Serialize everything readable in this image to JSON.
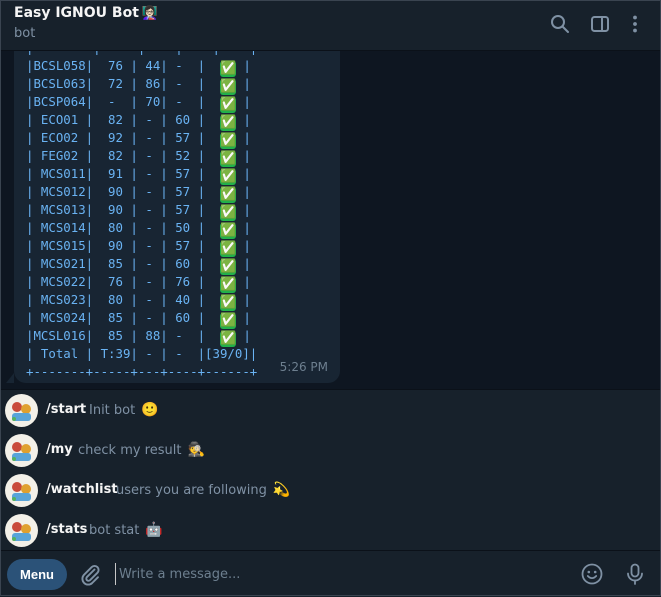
{
  "header": {
    "title": "Easy IGNOU Bot",
    "title_emoji": "👩🏻‍🏫",
    "subtitle": "bot",
    "icons": [
      "search-icon",
      "sidebar-icon",
      "more-vertical-icon"
    ]
  },
  "message": {
    "rows": [
      {
        "text": "|        |     |    |    |    |"
      },
      {
        "text": "|BCSL058|  76 | 44| -  |  ",
        "status": "✅",
        "end": " |"
      },
      {
        "text": "|BCSL063|  72 | 86| -  |  ",
        "status": "✅",
        "end": " |"
      },
      {
        "text": "|BCSP064|  -  | 70| -  |  ",
        "status": "✅",
        "end": " |"
      },
      {
        "text": "| ECO01 |  82 | - | 60 |  ",
        "status": "✅",
        "end": " |"
      },
      {
        "text": "| ECO02 |  92 | - | 57 |  ",
        "status": "✅",
        "end": " |"
      },
      {
        "text": "| FEG02 |  82 | - | 52 |  ",
        "status": "✅",
        "end": " |"
      },
      {
        "text": "| MCS011|  91 | - | 57 |  ",
        "status": "✅",
        "end": " |"
      },
      {
        "text": "| MCS012|  90 | - | 57 |  ",
        "status": "✅",
        "end": " |"
      },
      {
        "text": "| MCS013|  90 | - | 57 |  ",
        "status": "✅",
        "end": " |"
      },
      {
        "text": "| MCS014|  80 | - | 50 |  ",
        "status": "✅",
        "end": " |"
      },
      {
        "text": "| MCS015|  90 | - | 57 |  ",
        "status": "✅",
        "end": " |"
      },
      {
        "text": "| MCS021|  85 | - | 60 |  ",
        "status": "✅",
        "end": " |"
      },
      {
        "text": "| MCS022|  76 | - | 76 |  ",
        "status": "✅",
        "end": " |"
      },
      {
        "text": "| MCS023|  80 | - | 40 |  ",
        "status": "✅",
        "end": " |"
      },
      {
        "text": "| MCS024|  85 | - | 60 |  ",
        "status": "✅",
        "end": " |"
      },
      {
        "text": "|MCSL016|  85 | 88| -  |  ",
        "status": "✅",
        "end": " |"
      },
      {
        "text": "| Total | T:39| - | -  |[39/0]|"
      },
      {
        "text": "+-------+-----+---+----+------+"
      }
    ],
    "time": "5:26 PM"
  },
  "commands": [
    {
      "name": "/start",
      "desc": "Init bot",
      "emoji": "🙂"
    },
    {
      "name": "/my",
      "desc": "check my result",
      "emoji": "🕵️"
    },
    {
      "name": "/watchlist",
      "desc": "users you are following",
      "emoji": "💫"
    },
    {
      "name": "/stats",
      "desc": "bot stat",
      "emoji": "🤖"
    }
  ],
  "input": {
    "menu_label": "Menu",
    "placeholder": "Write a message..."
  },
  "colors": {
    "background": "#0e1621",
    "panel": "#17212b",
    "bubble": "#182533",
    "code_text": "#6ab3f3",
    "accent": "#2b5278",
    "check": "#21b14a"
  }
}
